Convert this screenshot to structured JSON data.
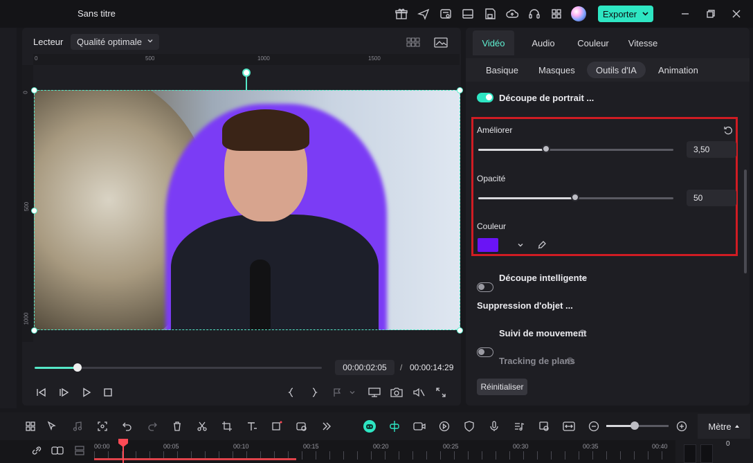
{
  "window": {
    "title": "Sans titre",
    "export_label": "Exporter"
  },
  "player": {
    "label": "Lecteur",
    "quality": "Qualité optimale",
    "ruler_top": [
      "0",
      "500",
      "1000",
      "1500"
    ],
    "ruler_left": [
      "0",
      "500",
      "1000"
    ],
    "time_current": "00:00:02:05",
    "time_separator": "/",
    "time_total": "00:00:14:29",
    "progress": 0.15
  },
  "inspector": {
    "tabs": [
      "Vidéo",
      "Audio",
      "Couleur",
      "Vitesse"
    ],
    "active_tab": "Vidéo",
    "subtabs": [
      "Basique",
      "Masques",
      "Outils d'IA",
      "Animation"
    ],
    "active_subtab": "Outils d'IA",
    "portrait_cutout": {
      "label": "Découpe de portrait ...",
      "enabled": true
    },
    "enhance": {
      "label": "Améliorer",
      "value": "3,50",
      "fraction": 0.35
    },
    "opacity": {
      "label": "Opacité",
      "value": "50",
      "fraction": 0.5
    },
    "color": {
      "label": "Couleur",
      "swatch": "#6a14f5"
    },
    "smart_cutout": {
      "label": "Découpe intelligente",
      "enabled": false
    },
    "object_removal": {
      "label": "Suppression d'objet ..."
    },
    "motion_tracking": {
      "label": "Suivi de mouvement",
      "enabled": false
    },
    "plane_tracking": {
      "label": "Tracking de plans",
      "enabled": false
    },
    "reset_label": "Réinitialiser"
  },
  "toolbar": {
    "meter_label": "Mètre",
    "zoom": 0.45
  },
  "timeline": {
    "ticks": [
      "00:00",
      "00:05",
      "00:10",
      "00:15",
      "00:20",
      "00:25",
      "00:30",
      "00:35",
      "00:40"
    ],
    "meter_zero": "0"
  },
  "colors": {
    "accent": "#2ee6c3",
    "highlight": "#d01c23",
    "playhead": "#ff4a55"
  }
}
